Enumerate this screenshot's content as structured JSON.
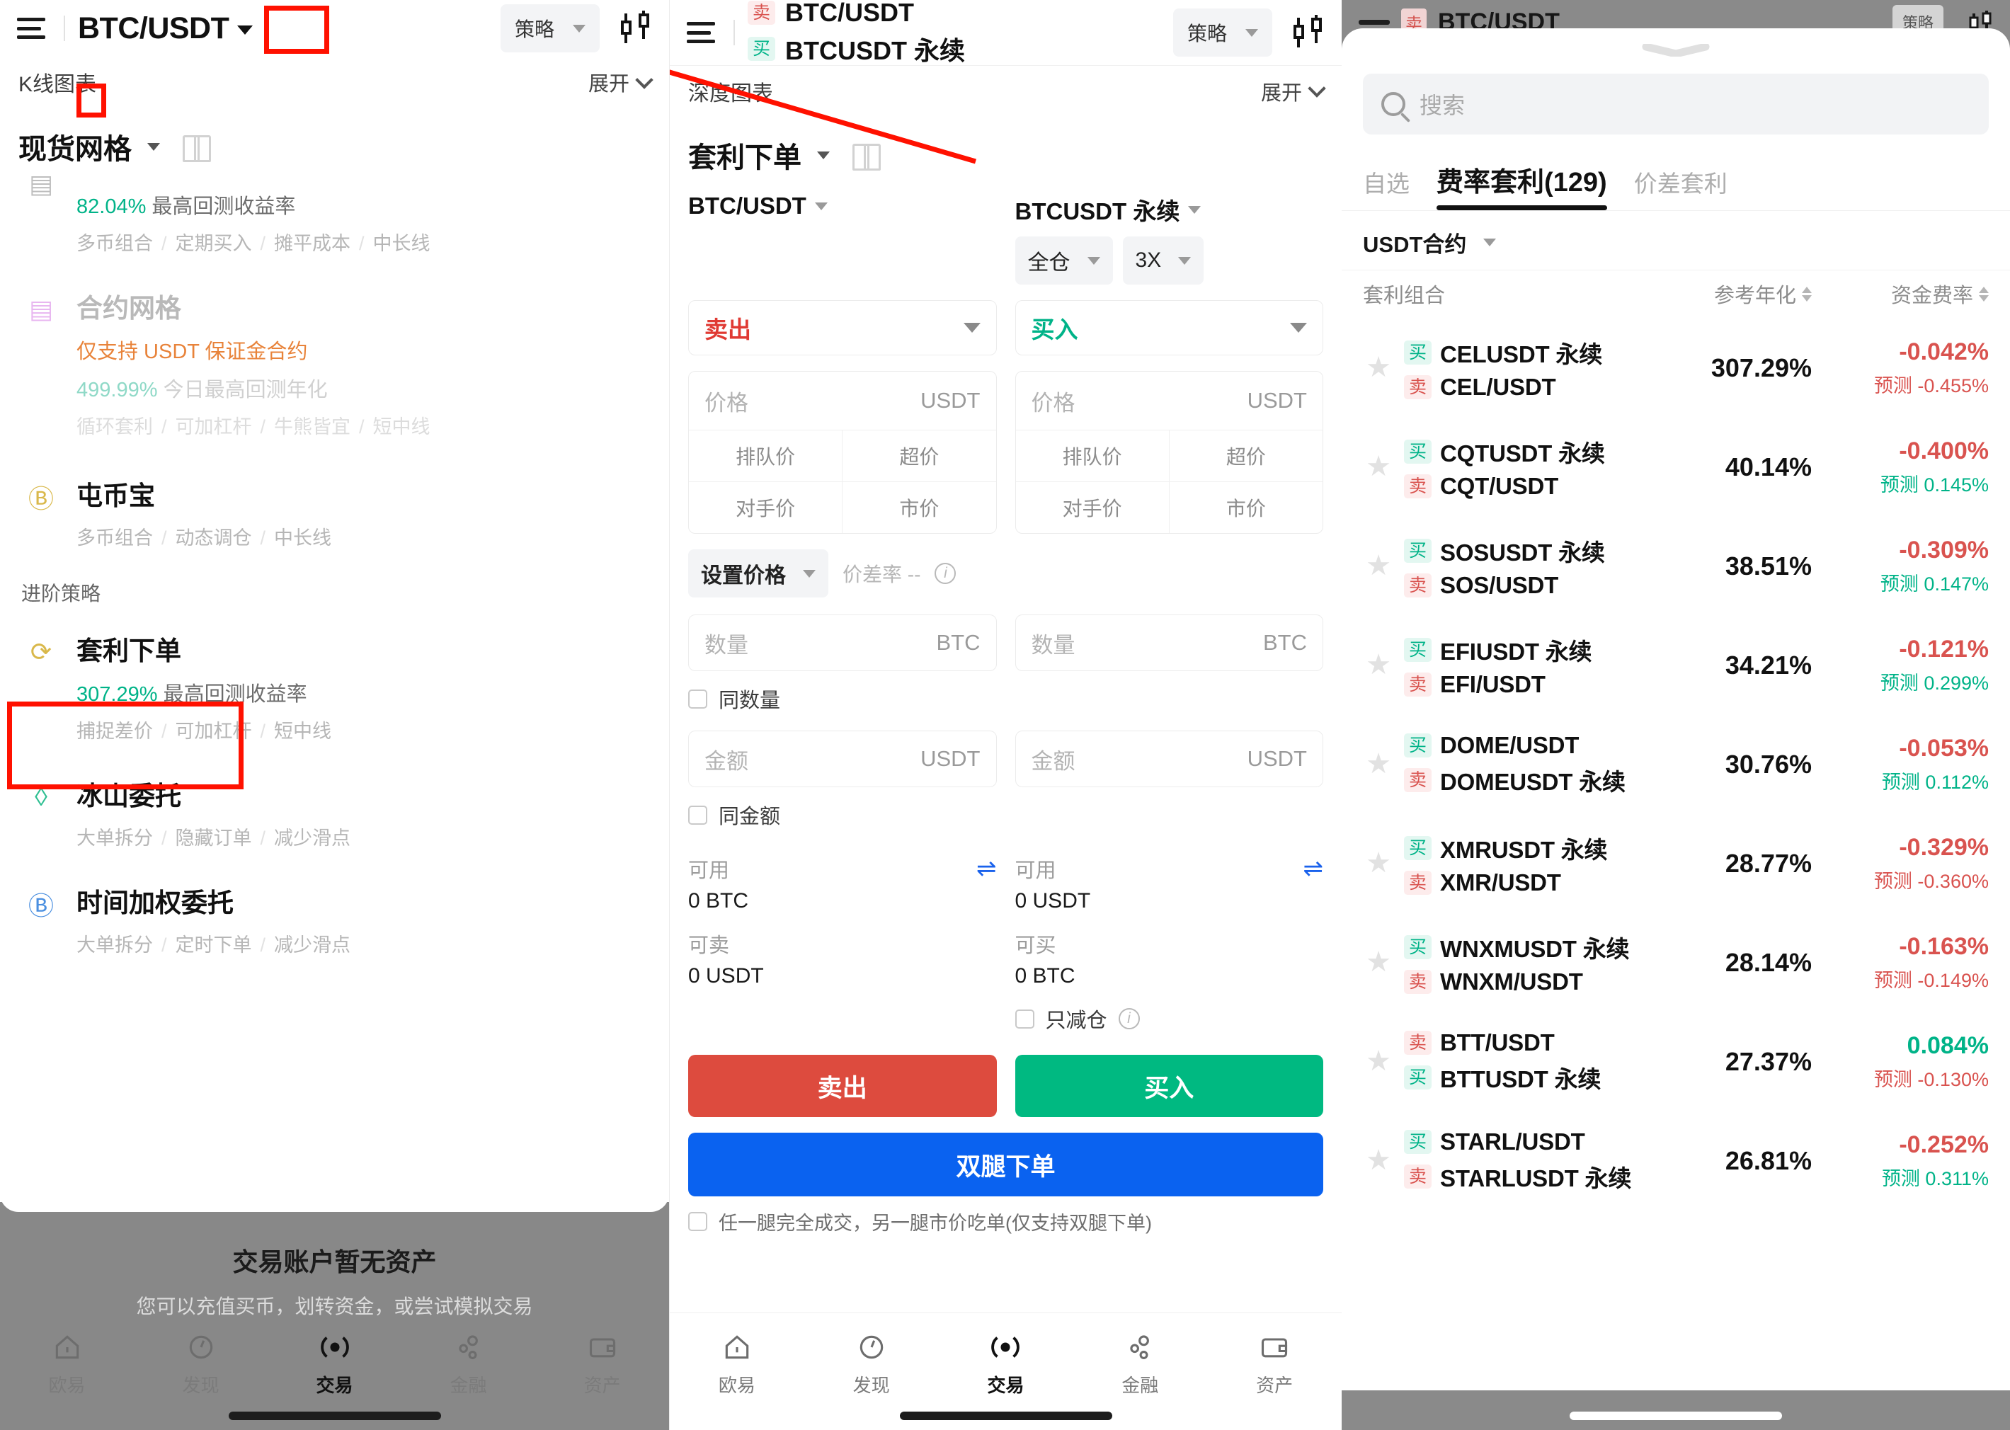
{
  "panel1": {
    "topbar": {
      "pair": "BTC/USDT",
      "strategy_chip": "策略"
    },
    "chart_row": {
      "label": "K线图表",
      "expand": "展开"
    },
    "selector": {
      "title": "现货网格"
    },
    "strategies": [
      {
        "name": "",
        "rate": "82.04%",
        "rate_label": "最高回测收益率",
        "tags": [
          "多币组合",
          "定期买入",
          "摊平成本",
          "中长线"
        ],
        "icon": "grid-icon"
      },
      {
        "name": "合约网格",
        "notice": "仅支持 USDT 保证金合约",
        "rate": "499.99%",
        "rate_label": "今日最高回测年化",
        "tags": [
          "循环套利",
          "可加杠杆",
          "牛熊皆宜",
          "短中线"
        ],
        "icon": "contract-grid-icon"
      },
      {
        "name": "屯币宝",
        "tags": [
          "多币组合",
          "动态调仓",
          "中长线"
        ],
        "icon": "coin-icon"
      }
    ],
    "group_title": "进阶策略",
    "advanced": [
      {
        "name": "套利下单",
        "rate": "307.29%",
        "rate_label": "最高回测收益率",
        "tags": [
          "捕捉差价",
          "可加杠杆",
          "短中线"
        ],
        "icon": "arbitrage-icon"
      },
      {
        "name": "冰山委托",
        "tags": [
          "大单拆分",
          "隐藏订单",
          "减少滑点"
        ],
        "icon": "iceberg-icon"
      },
      {
        "name": "时间加权委托",
        "tags": [
          "大单拆分",
          "定时下单",
          "减少滑点"
        ],
        "icon": "twap-icon"
      }
    ],
    "empty": {
      "title": "交易账户暂无资产",
      "subtitle": "您可以充值买币，划转资金，或尝试模拟交易"
    },
    "tabs": [
      {
        "label": "欧易",
        "icon": "home-icon",
        "active": false
      },
      {
        "label": "发现",
        "icon": "compass-icon",
        "active": false
      },
      {
        "label": "交易",
        "icon": "trade-icon",
        "active": true
      },
      {
        "label": "金融",
        "icon": "finance-icon",
        "active": false
      },
      {
        "label": "资产",
        "icon": "wallet-icon",
        "active": false
      }
    ]
  },
  "panel2": {
    "topbar": {
      "line1_badge": "卖",
      "line1_pair": "BTC/USDT",
      "line2_badge": "买",
      "line2_pair": "BTCUSDT 永续",
      "strategy_chip": "策略"
    },
    "chart_row": {
      "label": "深度图表",
      "expand": "展开"
    },
    "selector": {
      "title": "套利下单"
    },
    "left": {
      "market": "BTC/USDT",
      "side": "卖出",
      "price_placeholder": "价格",
      "price_unit": "USDT",
      "quick": [
        "排队价",
        "超价",
        "对手价",
        "市价"
      ],
      "qty_placeholder": "数量",
      "qty_unit": "BTC",
      "amount_placeholder": "金额",
      "amount_unit": "USDT",
      "avail_label": "可用",
      "avail_value": "0 BTC",
      "tradable_label": "可卖",
      "tradable_value": "0 USDT",
      "action": "卖出"
    },
    "right": {
      "market": "BTCUSDT 永续",
      "margin_mode": "全仓",
      "leverage": "3X",
      "side": "买入",
      "price_placeholder": "价格",
      "price_unit": "USDT",
      "quick": [
        "排队价",
        "超价",
        "对手价",
        "市价"
      ],
      "qty_placeholder": "数量",
      "qty_unit": "BTC",
      "amount_placeholder": "金额",
      "amount_unit": "USDT",
      "avail_label": "可用",
      "avail_value": "0 USDT",
      "tradable_label": "可买",
      "tradable_value": "0 BTC",
      "reduce_only": "只减仓",
      "action": "买入"
    },
    "set_price": "设置价格",
    "diff_rate": "价差率 --",
    "same_qty": "同数量",
    "same_amount": "同金额",
    "both_legs_button": "双腿下单",
    "both_legs_note": "任一腿完全成交，另一腿市价吃单(仅支持双腿下单)",
    "tabs": [
      {
        "label": "欧易",
        "icon": "home-icon",
        "active": false
      },
      {
        "label": "发现",
        "icon": "compass-icon",
        "active": false
      },
      {
        "label": "交易",
        "icon": "trade-icon",
        "active": true
      },
      {
        "label": "金融",
        "icon": "finance-icon",
        "active": false
      },
      {
        "label": "资产",
        "icon": "wallet-icon",
        "active": false
      }
    ]
  },
  "panel3": {
    "ghost": {
      "badge": "卖",
      "pair": "BTC/USDT",
      "chip": "策略"
    },
    "search_placeholder": "搜索",
    "tabs": [
      {
        "label": "自选",
        "active": false
      },
      {
        "label": "费率套利(129)",
        "active": true
      },
      {
        "label": "价差套利",
        "active": false
      }
    ],
    "filter": "USDT合约",
    "columns": {
      "combo": "套利组合",
      "apr": "参考年化",
      "funding": "资金费率"
    },
    "forecast_label": "预测",
    "rows": [
      {
        "leg1_side": "买",
        "leg1": "CELUSDT 永续",
        "leg2_side": "卖",
        "leg2": "CEL/USDT",
        "apr": "307.29%",
        "funding": "-0.042%",
        "funding_sign": "neg",
        "forecast": "-0.455%",
        "forecast_sign": "neg"
      },
      {
        "leg1_side": "买",
        "leg1": "CQTUSDT 永续",
        "leg2_side": "卖",
        "leg2": "CQT/USDT",
        "apr": "40.14%",
        "funding": "-0.400%",
        "funding_sign": "neg",
        "forecast": "0.145%",
        "forecast_sign": "pos"
      },
      {
        "leg1_side": "买",
        "leg1": "SOSUSDT 永续",
        "leg2_side": "卖",
        "leg2": "SOS/USDT",
        "apr": "38.51%",
        "funding": "-0.309%",
        "funding_sign": "neg",
        "forecast": "0.147%",
        "forecast_sign": "pos"
      },
      {
        "leg1_side": "买",
        "leg1": "EFIUSDT 永续",
        "leg2_side": "卖",
        "leg2": "EFI/USDT",
        "apr": "34.21%",
        "funding": "-0.121%",
        "funding_sign": "neg",
        "forecast": "0.299%",
        "forecast_sign": "pos"
      },
      {
        "leg1_side": "买",
        "leg1": "DOME/USDT",
        "leg2_side": "卖",
        "leg2": "DOMEUSDT 永续",
        "apr": "30.76%",
        "funding": "-0.053%",
        "funding_sign": "neg",
        "forecast": "0.112%",
        "forecast_sign": "pos"
      },
      {
        "leg1_side": "买",
        "leg1": "XMRUSDT 永续",
        "leg2_side": "卖",
        "leg2": "XMR/USDT",
        "apr": "28.77%",
        "funding": "-0.329%",
        "funding_sign": "neg",
        "forecast": "-0.360%",
        "forecast_sign": "neg"
      },
      {
        "leg1_side": "买",
        "leg1": "WNXMUSDT 永续",
        "leg2_side": "卖",
        "leg2": "WNXM/USDT",
        "apr": "28.14%",
        "funding": "-0.163%",
        "funding_sign": "neg",
        "forecast": "-0.149%",
        "forecast_sign": "neg"
      },
      {
        "leg1_side": "卖",
        "leg1": "BTT/USDT",
        "leg2_side": "买",
        "leg2": "BTTUSDT 永续",
        "apr": "27.37%",
        "funding": "0.084%",
        "funding_sign": "pos",
        "forecast": "-0.130%",
        "forecast_sign": "neg"
      },
      {
        "leg1_side": "买",
        "leg1": "STARL/USDT",
        "leg2_side": "卖",
        "leg2": "STARLUSDT 永续",
        "apr": "26.81%",
        "funding": "-0.252%",
        "funding_sign": "neg",
        "forecast": "0.311%",
        "forecast_sign": "pos"
      }
    ]
  },
  "colors": {
    "annotation": "#ff1100",
    "sell": "#d9534f",
    "buy": "#00b388",
    "both": "#0a62f0"
  }
}
